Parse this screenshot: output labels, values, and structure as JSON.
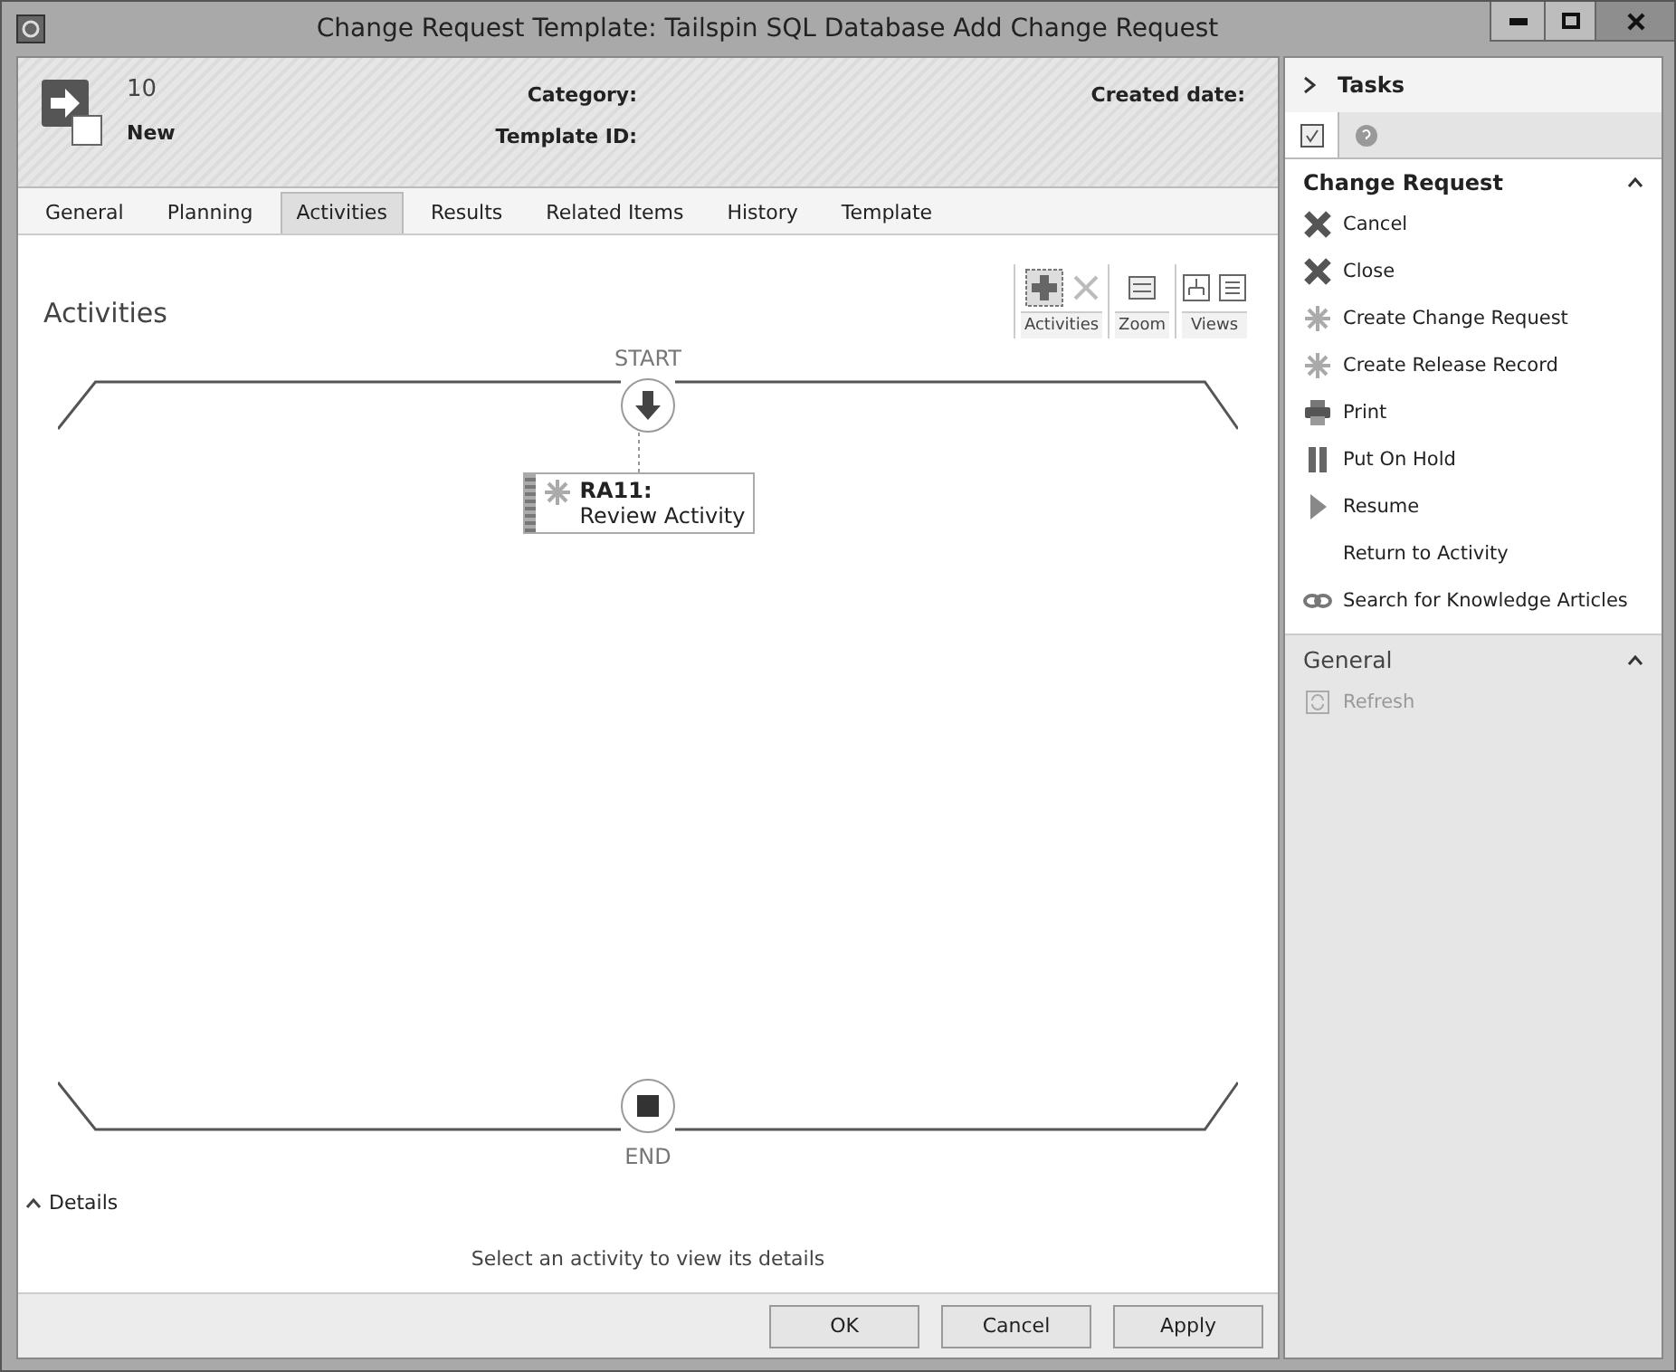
{
  "window": {
    "title": "Change Request Template: Tailspin SQL Database Add Change Request"
  },
  "header": {
    "id": "10",
    "status": "New",
    "fields": [
      {
        "label": "Category:"
      },
      {
        "label": "Template ID:"
      },
      {
        "label": "Created date:"
      }
    ]
  },
  "tabs": [
    {
      "label": "General",
      "selected": false
    },
    {
      "label": "Planning",
      "selected": false
    },
    {
      "label": "Activities",
      "selected": true
    },
    {
      "label": "Results",
      "selected": false
    },
    {
      "label": "Related Items",
      "selected": false
    },
    {
      "label": "History",
      "selected": false
    },
    {
      "label": "Template",
      "selected": false
    }
  ],
  "activities": {
    "title": "Activities",
    "toolbar_groups": [
      {
        "label": "Activities",
        "tools": [
          {
            "kind": "add",
            "disabled": false
          },
          {
            "kind": "remove",
            "disabled": true
          }
        ]
      },
      {
        "label": "Zoom",
        "tools": [
          {
            "kind": "zoom",
            "disabled": false
          }
        ]
      },
      {
        "label": "Views",
        "tools": [
          {
            "kind": "tree",
            "disabled": false
          },
          {
            "kind": "list",
            "disabled": false
          }
        ]
      }
    ],
    "start_label": "START",
    "end_label": "END",
    "nodes": [
      {
        "id": "RA11:",
        "name": "Review Activity"
      }
    ]
  },
  "details": {
    "toggle": "Details",
    "expanded": true,
    "message": "Select an activity to view its details"
  },
  "buttons": [
    "OK",
    "Cancel",
    "Apply"
  ],
  "tasks_pane": {
    "title": "Tasks",
    "sections": [
      {
        "title": "Change Request",
        "expanded": true,
        "items": [
          {
            "label": "Cancel",
            "kind": "cross",
            "disabled": false
          },
          {
            "label": "Close",
            "kind": "cross",
            "disabled": false
          },
          {
            "label": "Create Change Request",
            "kind": "star",
            "disabled": false
          },
          {
            "label": "Create Release Record",
            "kind": "star",
            "disabled": false
          },
          {
            "label": "Print",
            "kind": "printer",
            "disabled": false
          },
          {
            "label": "Put On Hold",
            "kind": "pause",
            "disabled": false
          },
          {
            "label": "Resume",
            "kind": "play",
            "disabled": false
          },
          {
            "label": "Return to Activity",
            "kind": "none",
            "disabled": false
          },
          {
            "label": "Search for Knowledge Articles",
            "kind": "link",
            "disabled": false
          }
        ]
      },
      {
        "title": "General",
        "expanded": true,
        "items": [
          {
            "label": "Refresh",
            "kind": "refresh",
            "disabled": true
          }
        ]
      }
    ]
  }
}
